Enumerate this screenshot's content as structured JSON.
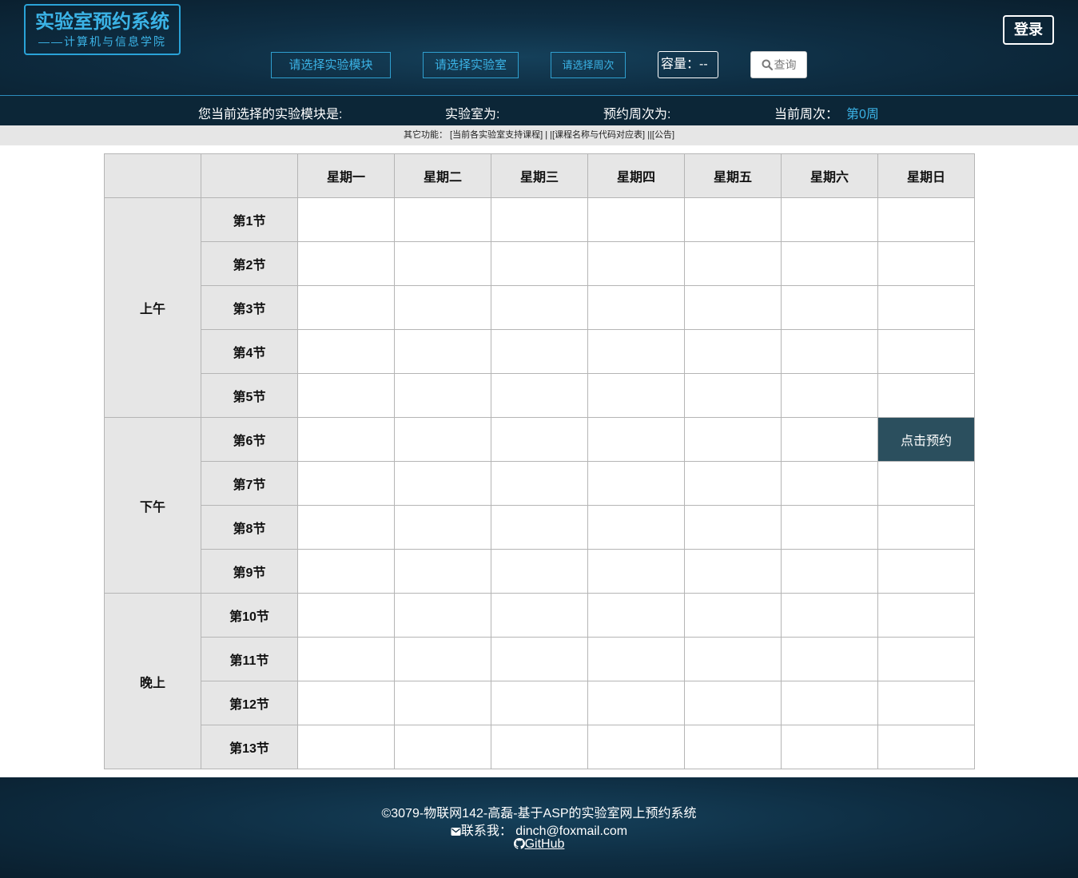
{
  "header": {
    "logo_title": "实验室预约系统",
    "logo_subtitle": "——计算机与信息学院",
    "login_label": "登录",
    "select_module": "请选择实验模块",
    "select_lab": "请选择实验室",
    "select_week": "请选择周次",
    "capacity": "容量：--",
    "query_label": "查询"
  },
  "info": {
    "module_label": "您当前选择的实验模块是:",
    "lab_label": "实验室为:",
    "week_label": "预约周次为:",
    "current_week_label": "当前周次：",
    "current_week_value": "第0周"
  },
  "functions": {
    "prefix": "其它功能：",
    "link1": "[当前各实验室支持课程]",
    "link2": "[课程名称与代码对应表]",
    "link3": "[公告]",
    "sep": "|"
  },
  "schedule": {
    "days": [
      "星期一",
      "星期二",
      "星期三",
      "星期四",
      "星期五",
      "星期六",
      "星期日"
    ],
    "periods": [
      "上午",
      "下午",
      "晚上"
    ],
    "slots": [
      "第1节",
      "第2节",
      "第3节",
      "第4节",
      "第5节",
      "第6节",
      "第7节",
      "第8节",
      "第9节",
      "第10节",
      "第11节",
      "第12节",
      "第13节"
    ],
    "reserve_label": "点击预约"
  },
  "footer": {
    "copyright": "©3079-物联网142-高磊-基于ASP的实验室网上预约系统",
    "contact": "联系我：  dinch@foxmail.com",
    "github": "GitHub"
  },
  "colors": {
    "accent": "#3bb3e6",
    "header_bg": "#0e2d42",
    "reserve_bg": "#2b4f5e",
    "table_header_bg": "#e6e6e6"
  }
}
